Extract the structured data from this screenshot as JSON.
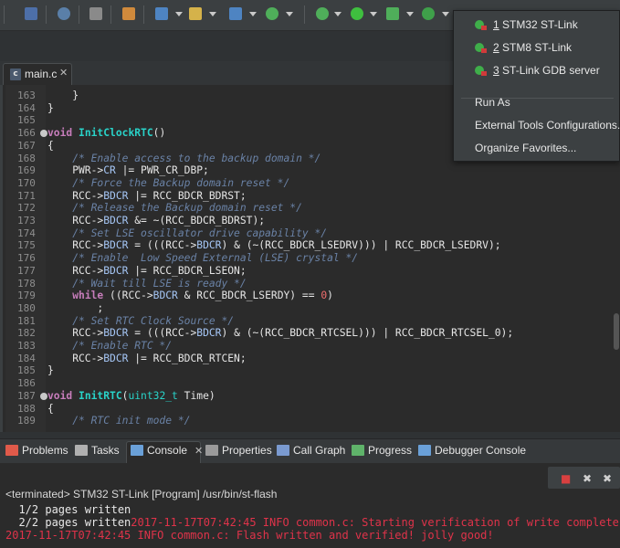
{
  "toolbar": {
    "icons": [
      "new-icon",
      "print-icon",
      "search-icon",
      "build-icon",
      "debug-config-icon",
      "new-class-icon",
      "open-type-icon",
      "new-c-file-icon",
      "refresh-icon",
      "run-icon",
      "debug-icon",
      "external-tools-icon"
    ]
  },
  "editor": {
    "tab_label": "main.c",
    "tab_close": "✕",
    "lines": [
      {
        "n": "163",
        "parts": [
          [
            "t",
            "    }"
          ]
        ]
      },
      {
        "n": "164",
        "parts": [
          [
            "t",
            "}"
          ]
        ]
      },
      {
        "n": "165",
        "parts": [
          [
            "t",
            ""
          ]
        ]
      },
      {
        "n": "166",
        "fold": true,
        "parts": [
          [
            "kw",
            "void"
          ],
          [
            "t",
            " "
          ],
          [
            "fn",
            "InitClockRTC"
          ],
          [
            "t",
            "()"
          ]
        ]
      },
      {
        "n": "167",
        "parts": [
          [
            "t",
            "{"
          ]
        ]
      },
      {
        "n": "168",
        "parts": [
          [
            "t",
            "    "
          ],
          [
            "cm",
            "/* Enable access to the backup domain */"
          ]
        ]
      },
      {
        "n": "169",
        "parts": [
          [
            "t",
            "    PWR->"
          ],
          [
            "fld",
            "CR"
          ],
          [
            "t",
            " |= PWR_CR_DBP;"
          ]
        ]
      },
      {
        "n": "170",
        "parts": [
          [
            "t",
            "    "
          ],
          [
            "cm",
            "/* Force the Backup domain reset */"
          ]
        ]
      },
      {
        "n": "171",
        "parts": [
          [
            "t",
            "    RCC->"
          ],
          [
            "fld",
            "BDCR"
          ],
          [
            "t",
            " |= RCC_BDCR_BDRST;"
          ]
        ]
      },
      {
        "n": "172",
        "parts": [
          [
            "t",
            "    "
          ],
          [
            "cm",
            "/* Release the Backup domain reset */"
          ]
        ]
      },
      {
        "n": "173",
        "parts": [
          [
            "t",
            "    RCC->"
          ],
          [
            "fld",
            "BDCR"
          ],
          [
            "t",
            " &= ~(RCC_BDCR_BDRST);"
          ]
        ]
      },
      {
        "n": "174",
        "parts": [
          [
            "t",
            "    "
          ],
          [
            "cm",
            "/* Set LSE oscillator drive capability */"
          ]
        ]
      },
      {
        "n": "175",
        "parts": [
          [
            "t",
            "    RCC->"
          ],
          [
            "fld",
            "BDCR"
          ],
          [
            "t",
            " = (((RCC->"
          ],
          [
            "fld",
            "BDCR"
          ],
          [
            "t",
            ") & (~(RCC_BDCR_LSEDRV))) | RCC_BDCR_LSEDRV);"
          ]
        ]
      },
      {
        "n": "176",
        "parts": [
          [
            "t",
            "    "
          ],
          [
            "cm",
            "/* Enable  Low Speed External (LSE) crystal */"
          ]
        ]
      },
      {
        "n": "177",
        "parts": [
          [
            "t",
            "    RCC->"
          ],
          [
            "fld",
            "BDCR"
          ],
          [
            "t",
            " |= RCC_BDCR_LSEON;"
          ]
        ]
      },
      {
        "n": "178",
        "parts": [
          [
            "t",
            "    "
          ],
          [
            "cm",
            "/* Wait till LSE is ready */"
          ]
        ]
      },
      {
        "n": "179",
        "parts": [
          [
            "t",
            "    "
          ],
          [
            "kw",
            "while"
          ],
          [
            "t",
            " ((RCC->"
          ],
          [
            "fld",
            "BDCR"
          ],
          [
            "t",
            " & RCC_BDCR_LSERDY) == "
          ],
          [
            "num",
            "0"
          ],
          [
            "t",
            ")"
          ]
        ]
      },
      {
        "n": "180",
        "parts": [
          [
            "t",
            "        ;"
          ]
        ]
      },
      {
        "n": "181",
        "parts": [
          [
            "t",
            "    "
          ],
          [
            "cm",
            "/* Set RTC Clock Source */"
          ]
        ]
      },
      {
        "n": "182",
        "parts": [
          [
            "t",
            "    RCC->"
          ],
          [
            "fld",
            "BDCR"
          ],
          [
            "t",
            " = (((RCC->"
          ],
          [
            "fld",
            "BDCR"
          ],
          [
            "t",
            ") & (~(RCC_BDCR_RTCSEL))) | RCC_BDCR_RTCSEL_0);"
          ]
        ]
      },
      {
        "n": "183",
        "parts": [
          [
            "t",
            "    "
          ],
          [
            "cm",
            "/* Enable RTC */"
          ]
        ]
      },
      {
        "n": "184",
        "parts": [
          [
            "t",
            "    RCC->"
          ],
          [
            "fld",
            "BDCR"
          ],
          [
            "t",
            " |= RCC_BDCR_RTCEN;"
          ]
        ]
      },
      {
        "n": "185",
        "parts": [
          [
            "t",
            "}"
          ]
        ]
      },
      {
        "n": "186",
        "parts": [
          [
            "t",
            ""
          ]
        ]
      },
      {
        "n": "187",
        "fold": true,
        "parts": [
          [
            "kw",
            "void"
          ],
          [
            "t",
            " "
          ],
          [
            "fn",
            "InitRTC"
          ],
          [
            "t",
            "("
          ],
          [
            "ty",
            "uint32_t"
          ],
          [
            "t",
            " Time)"
          ]
        ]
      },
      {
        "n": "188",
        "parts": [
          [
            "t",
            "{"
          ]
        ]
      },
      {
        "n": "189",
        "parts": [
          [
            "t",
            "    "
          ],
          [
            "cm",
            "/* RTC init mode */"
          ]
        ]
      }
    ]
  },
  "menu": {
    "items": [
      {
        "num": "1",
        "label": " STM32 ST-Link",
        "icon": "debug-launch-icon"
      },
      {
        "num": "2",
        "label": " STM8  ST-Link",
        "icon": "debug-launch-icon"
      },
      {
        "num": "3",
        "label": " ST-Link GDB server",
        "icon": "debug-launch-icon"
      },
      {
        "label": "Run As"
      },
      {
        "label": "External Tools Configurations..."
      },
      {
        "label": "Organize Favorites..."
      }
    ]
  },
  "panel": {
    "tabs": [
      {
        "label": "Problems",
        "icon": "problems-icon",
        "color": "#e05a4a"
      },
      {
        "label": "Tasks",
        "icon": "tasks-icon",
        "color": "#b0b0b0"
      },
      {
        "label": "Console",
        "icon": "console-icon",
        "color": "#6aa0d8",
        "close": "✕"
      },
      {
        "label": "Properties",
        "icon": "properties-icon",
        "color": "#9a9a9a"
      },
      {
        "label": "Call Graph",
        "icon": "call-graph-icon",
        "color": "#7a9ad0"
      },
      {
        "label": "Progress",
        "icon": "progress-icon",
        "color": "#5fb36a"
      },
      {
        "label": "Debugger Console",
        "icon": "debugger-console-icon",
        "color": "#6aa0d8"
      }
    ]
  },
  "console": {
    "title": "<terminated> STM32 ST-Link [Program] /usr/bin/st-flash",
    "toolbar": [
      "■",
      "✖",
      "✖"
    ],
    "lines": [
      {
        "ok": "  1/2 pages written",
        "er": ""
      },
      {
        "ok": "  2/2 pages written",
        "er": "2017-11-17T07:42:45 INFO common.c: Starting verification of write complete"
      },
      {
        "ok": "",
        "er": "2017-11-17T07:42:45 INFO common.c: Flash written and verified! jolly good!"
      }
    ]
  },
  "colors": {
    "accent": "#29d3c9",
    "error": "#e0334a",
    "comment": "#6a82a6",
    "keyword": "#c77dbb"
  }
}
